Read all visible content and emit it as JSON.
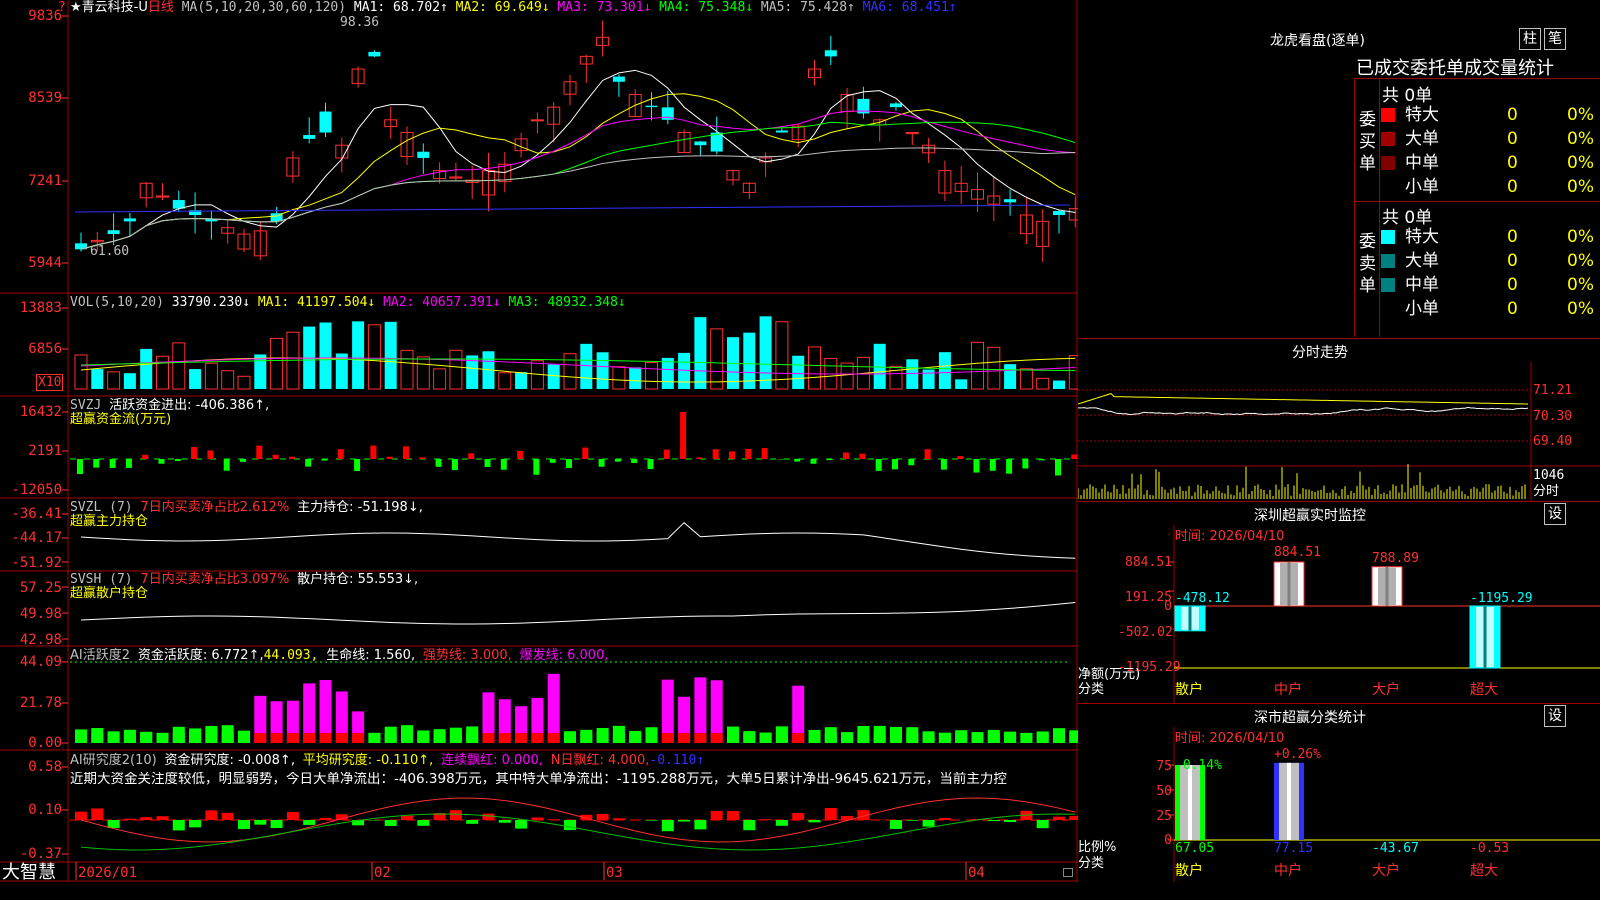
{
  "main_panel": {
    "legend": {
      "stock_name": "★青云科技-U",
      "period": "日线",
      "ma_spec": "MA(5,10,20,30,60,120)",
      "ma1": "MA1: 68.702↑",
      "ma2": "MA2: 69.649↓",
      "ma3": "MA3: 73.301↓",
      "ma4": "MA4: 75.348↓",
      "ma5": "MA5: 75.428↑",
      "ma6": "MA6: 68.451↑"
    },
    "y_ticks": [
      "9836",
      "8539",
      "7241",
      "5944"
    ],
    "high_label": "98.36",
    "low_label": "61.60",
    "corner_mark": "?"
  },
  "vol_panel": {
    "legend": {
      "spec": "VOL(5,10,20)",
      "value": "33790.230↓",
      "ma1": "MA1: 41197.504↓",
      "ma2": "MA2: 40657.391↓",
      "ma3": "MA3: 48932.348↓"
    },
    "y_ticks": [
      "13883",
      "6856"
    ],
    "unit": "X10"
  },
  "svzj_panel": {
    "legend": {
      "spec": "SVZJ",
      "label": "活跃资金进出: -406.386↑,",
      "title": "超赢资金流(万元)"
    },
    "y_ticks": [
      "16432",
      "2191",
      "-12050"
    ]
  },
  "svzl_panel": {
    "legend": {
      "spec": "SVZL (7)",
      "ratio": "7日内买卖净占比2.612%",
      "label": "主力持仓: -51.198↓,",
      "title": "超赢主力持仓"
    },
    "y_ticks": [
      "-36.41",
      "-44.17",
      "-51.92"
    ]
  },
  "svsh_panel": {
    "legend": {
      "spec": "SVSH (7)",
      "ratio": "7日内买卖净占比3.097%",
      "label": "散户持仓: 55.553↓,",
      "title": "超赢散户持仓"
    },
    "y_ticks": [
      "57.25",
      "49.98",
      "42.98"
    ]
  },
  "ai_active_panel": {
    "legend": {
      "spec": "AI活跃度2",
      "a": "资金活跃度: 6.772↑,",
      "b": "44.093,",
      "c": "生命线: 1.560,",
      "d": "强势线: 3.000,",
      "e": "爆发线: 6.000,"
    },
    "y_ticks": [
      "44.09",
      "21.78",
      "0.00"
    ]
  },
  "ai_research_panel": {
    "legend": {
      "spec": "AI研究度2(10)",
      "a": "资金研究度: -0.008↑,",
      "b": "平均研究度: -0.110↑,",
      "c": "连续飘红: 0.000,",
      "d": "N日飘红: 4.000,",
      "e": "-0.110↑"
    },
    "commentary": "近期大资金关注度较低，明显弱势，今日大单净流出：-406.398万元，其中特大单净流出：-1195.288万元，大单5日累计净出-9645.621万元，当前主力控",
    "y_ticks": [
      "0.58",
      "0.10",
      "-0.37"
    ]
  },
  "time_axis": {
    "labels": [
      "2026/01",
      "02",
      "03",
      "04"
    ],
    "brand": "大智慧"
  },
  "dragon_tiger": {
    "title": "龙虎看盘(逐单)",
    "tab_bar": "柱",
    "tab_tick": "笔",
    "header": "已成交委托单成交量统计",
    "buy_side": {
      "label": "委买单",
      "count": "共 0单",
      "rows": [
        {
          "name": "特大",
          "value": "0",
          "pct": "0%",
          "color": "#ff0000"
        },
        {
          "name": "大单",
          "value": "0",
          "pct": "0%",
          "color": "#a00000"
        },
        {
          "name": "中单",
          "value": "0",
          "pct": "0%",
          "color": "#800000"
        },
        {
          "name": "小单",
          "value": "0",
          "pct": "0%",
          "color": "#000000"
        }
      ]
    },
    "sell_side": {
      "label": "委卖单",
      "count": "共 0单",
      "rows": [
        {
          "name": "特大",
          "value": "0",
          "pct": "0%",
          "color": "#00ffff"
        },
        {
          "name": "大单",
          "value": "0",
          "pct": "0%",
          "color": "#008080"
        },
        {
          "name": "中单",
          "value": "0",
          "pct": "0%",
          "color": "#008080"
        },
        {
          "name": "小单",
          "value": "0",
          "pct": "0%",
          "color": "#000000"
        }
      ]
    }
  },
  "intraday": {
    "title": "分时走势",
    "y_ticks": [
      "71.21",
      "70.30",
      "69.40"
    ],
    "vol_label": "1046",
    "vol_unit": "分时"
  },
  "sz_monitor": {
    "title": "深圳超赢实时监控",
    "set_button": "设",
    "time": "时间: 2026/04/10",
    "y_ticks": [
      "884.51",
      "191.25",
      "0",
      "-502.02",
      "-1195.29"
    ],
    "y_title": "净额(万元)",
    "x_title": "分类",
    "chart_data": {
      "type": "bar",
      "categories": [
        "散户",
        "中户",
        "大户",
        "超大"
      ],
      "values": [
        -478.12,
        884.51,
        788.89,
        -1195.29
      ],
      "value_labels": [
        "-478.12",
        "884.51",
        "788.89",
        "-1195.29"
      ],
      "ylim": [
        -1195.29,
        884.51
      ]
    }
  },
  "sz_category": {
    "title": "深市超赢分类统计",
    "set_button": "设",
    "time": "时间: 2026/04/10",
    "y_ticks": [
      "75",
      "50",
      "25",
      "0"
    ],
    "y_title": "比例%",
    "x_title": "分类",
    "chart_data": {
      "type": "bar",
      "categories": [
        "散户",
        "中户",
        "大户",
        "超大"
      ],
      "values": [
        75,
        77.15,
        0,
        0
      ],
      "top_labels": [
        "-0.14%",
        "+0.26%",
        "",
        ""
      ],
      "bottom_labels": [
        "67.05",
        "77.15",
        "-43.67",
        "-0.53"
      ],
      "ylim": [
        0,
        75
      ]
    }
  }
}
